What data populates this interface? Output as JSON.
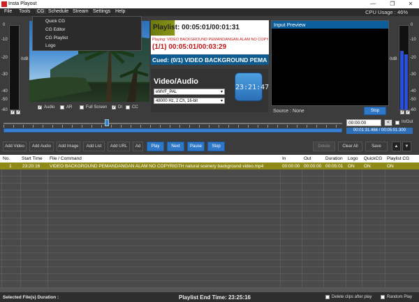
{
  "window": {
    "title": "Insta Playout",
    "minimize": "—",
    "restore": "❐",
    "close": "✕"
  },
  "menu": [
    "File",
    "Tools",
    "CG",
    "Schedule",
    "Stream",
    "Settings",
    "Help"
  ],
  "cpu_usage": "CPU Usage : 46%",
  "cg_menu": [
    "Quick CG",
    "CG Editor",
    "CG Playlist",
    "Logo"
  ],
  "meters": {
    "left": {
      "labels": [
        "0",
        "-10",
        "-20",
        "-30",
        "-40",
        "-50",
        "-60"
      ],
      "db": "0dB",
      "level": 0.62
    },
    "right": {
      "labels": [
        "0",
        "-10",
        "-20",
        "-30",
        "-40",
        "-50",
        "-60"
      ],
      "db": "0dB",
      "level": 0.7
    }
  },
  "preview_opts": [
    "Audio",
    "AR",
    "Full Screen",
    "DI",
    "CC"
  ],
  "playlist": {
    "title": "Playlist: 00:05:01/00:01:31",
    "playing_label": "Playing: VIDEO BACKGROUND PEMANDANGAN ALAM NO COPY",
    "counter": "(1/1) 00:05:01/00:03:29",
    "cued": "Cued: (0/1) VIDEO BACKGROUND PEMA"
  },
  "video_audio": {
    "title": "Video/Audio",
    "format": "eMVF_PAL",
    "audio": "48000 Hz, 2 Ch, 16-bit",
    "clock": "23:21:47"
  },
  "input_preview": {
    "title": "Input Preview",
    "source": "Source : None",
    "stop_label": "Stop"
  },
  "transport": {
    "time_input": "00:00:00",
    "inout_label": "In/Out",
    "position": "00:01:31.466 / 00:05:01.300",
    "progress": 0.3
  },
  "toolbar": {
    "add_video": "Add Video",
    "add_audio": "Add Audio",
    "add_image": "Add Image",
    "add_list": "Add List",
    "add_url": "Add URL",
    "add_more": "Ad",
    "play": "Play",
    "next": "Next",
    "pause": "Pause",
    "stop": "Stop",
    "delete": "Delete",
    "clear_all": "Clear All",
    "save": "Save",
    "up": "▲",
    "down": "▼"
  },
  "table": {
    "columns": [
      "No.",
      "Start Time",
      "File / Command",
      "In",
      "Out",
      "Duration",
      "Logo",
      "QuickCG",
      "Playlist CG"
    ],
    "rows": [
      [
        "1",
        "23:20:16",
        "VIDEO BACKGROUND PEMANDANGAN ALAM NO COPYRIGTH natural scenery background video.mp4",
        "00:00:00",
        "00:00:00",
        "00:05:01",
        "ON",
        "ON",
        "ON"
      ]
    ]
  },
  "status": {
    "selected": "Selected File(s) Duration :",
    "end_time": "Playlist End Time: 23:25:16",
    "delete_after": "Delete clips after play",
    "random": "Random Play"
  }
}
